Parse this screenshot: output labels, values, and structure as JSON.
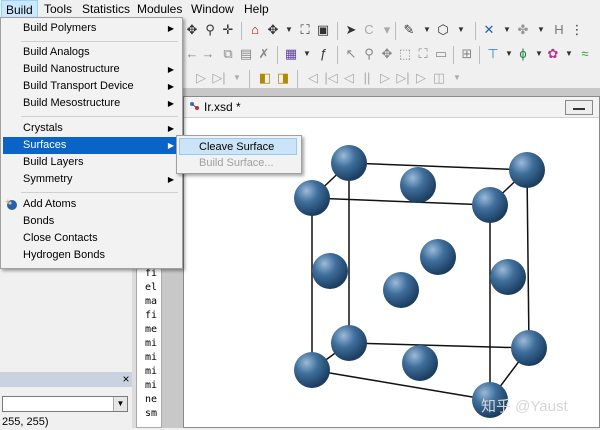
{
  "menubar": {
    "items": [
      {
        "label": "Build",
        "active": true
      },
      {
        "label": "Tools"
      },
      {
        "label": "Statistics"
      },
      {
        "label": "Modules"
      },
      {
        "label": "Window"
      },
      {
        "label": "Help"
      }
    ]
  },
  "build_menu": {
    "items": [
      {
        "label": "Build Polymers",
        "submenu": true
      },
      {
        "label": "Build Analogs"
      },
      {
        "label": "Build Nanostructure",
        "submenu": true
      },
      {
        "label": "Build Transport Device",
        "submenu": true
      },
      {
        "label": "Build Mesostructure",
        "submenu": true
      },
      {
        "label": "Crystals",
        "submenu": true
      },
      {
        "label": "Surfaces",
        "submenu": true,
        "highlighted": true
      },
      {
        "label": "Build Layers"
      },
      {
        "label": "Symmetry",
        "submenu": true
      },
      {
        "label": "Add Atoms",
        "icon": "add-atoms-icon"
      },
      {
        "label": "Bonds"
      },
      {
        "label": "Close Contacts"
      },
      {
        "label": "Hydrogen Bonds"
      }
    ]
  },
  "surfaces_submenu": {
    "items": [
      {
        "label": "Cleave Surface",
        "highlighted": true
      },
      {
        "label": "Build Surface...",
        "disabled": true
      }
    ]
  },
  "document": {
    "title": "Ir.xsd *"
  },
  "left_panel": {
    "rgb_readout": "255, 255)"
  },
  "text_pane": {
    "lines": [
      "fi",
      "el",
      "ma",
      "fi",
      "me",
      "mi",
      "mi",
      "mi",
      "mi",
      "ne",
      "sm"
    ]
  },
  "watermark": "知乎 @Yaust",
  "colors": {
    "menu_highlight": "#0a64c8",
    "submenu_highlight": "#cce4f7",
    "atom": "#2f5f8a"
  }
}
